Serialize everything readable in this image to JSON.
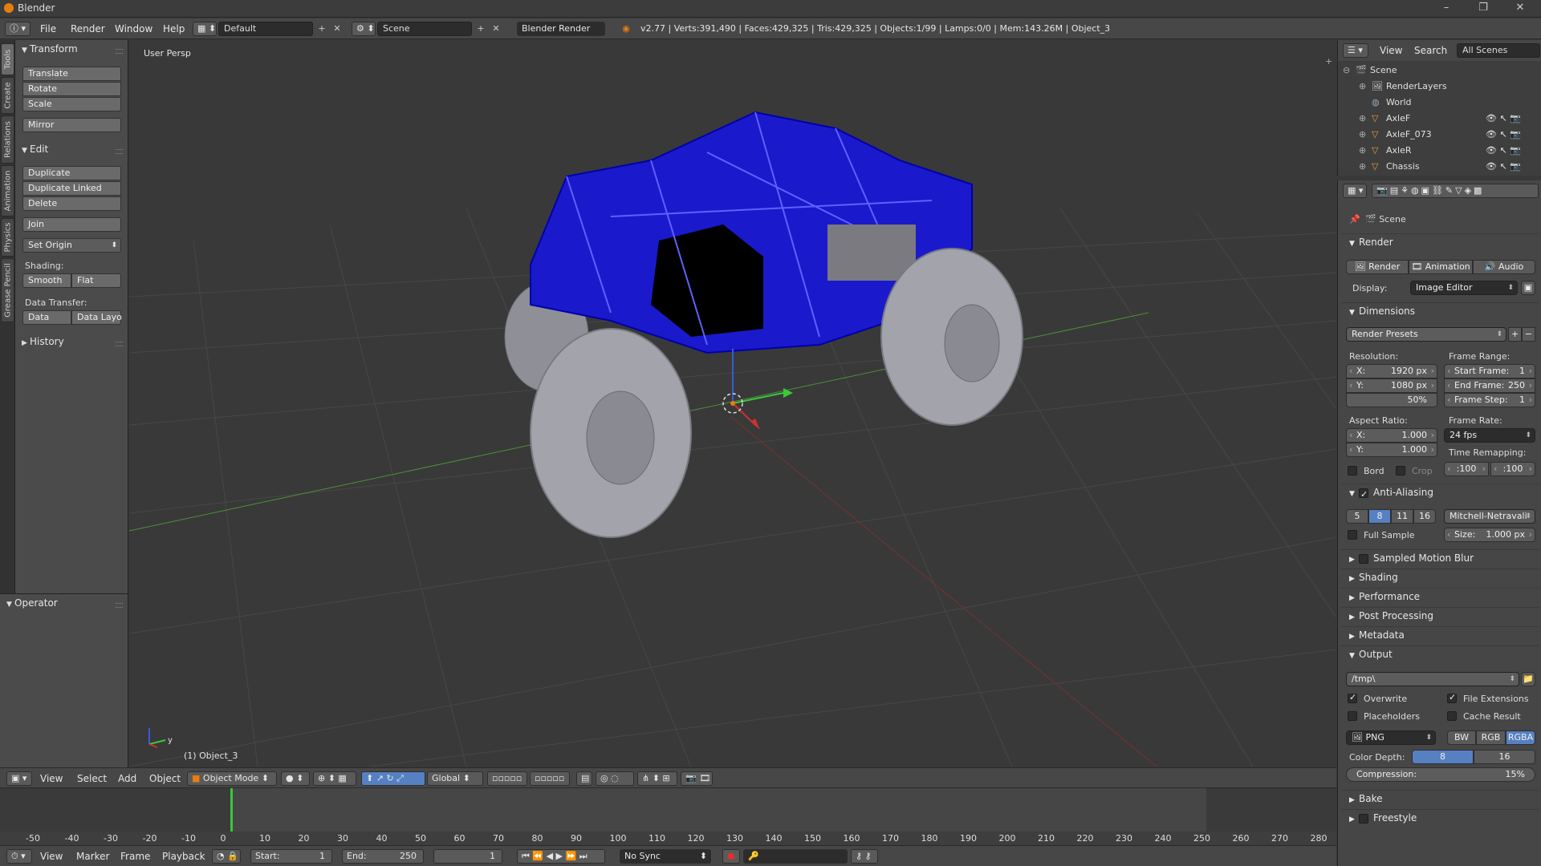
{
  "title_bar": {
    "title": "Blender",
    "minimize": "–",
    "maximize": "❐",
    "close": "✕"
  },
  "info_header": {
    "menus": [
      "File",
      "Render",
      "Window",
      "Help"
    ],
    "layout": "Default",
    "scene": "Scene",
    "engine": "Blender Render",
    "stats": "v2.77 | Verts:391,490 | Faces:429,325 | Tris:429,325 | Objects:1/99 | Lamps:0/0 | Mem:143.26M | Object_3"
  },
  "vertical_tabs": [
    "Tools",
    "Create",
    "Relations",
    "Animation",
    "Physics",
    "Grease Pencil"
  ],
  "tool_shelf": {
    "transform_header": "Transform",
    "translate": "Translate",
    "rotate": "Rotate",
    "scale": "Scale",
    "mirror": "Mirror",
    "edit_header": "Edit",
    "duplicate": "Duplicate",
    "duplicate_linked": "Duplicate Linked",
    "delete": "Delete",
    "join": "Join",
    "set_origin": "Set Origin",
    "shading_label": "Shading:",
    "smooth": "Smooth",
    "flat": "Flat",
    "data_transfer_label": "Data Transfer:",
    "data": "Data",
    "data_layout": "Data Layo",
    "history_header": "History"
  },
  "operator_panel": {
    "header": "Operator"
  },
  "viewport": {
    "view_name": "User Persp",
    "object_name": "(1) Object_3",
    "axis_y": "y"
  },
  "view3d_header": {
    "menus": [
      "View",
      "Select",
      "Add",
      "Object"
    ],
    "mode": "Object Mode",
    "orientation": "Global"
  },
  "timeline": {
    "ruler_labels": [
      "-50",
      "-40",
      "-30",
      "-20",
      "-10",
      "0",
      "10",
      "20",
      "30",
      "40",
      "50",
      "60",
      "70",
      "80",
      "90",
      "100",
      "110",
      "120",
      "130",
      "140",
      "150",
      "160",
      "170",
      "180",
      "190",
      "200",
      "210",
      "220",
      "230",
      "240",
      "250",
      "260",
      "270",
      "280"
    ],
    "menus": [
      "View",
      "Marker",
      "Frame",
      "Playback"
    ],
    "start_label": "Start:",
    "start_value": "1",
    "end_label": "End:",
    "end_value": "250",
    "current_frame": "1",
    "sync": "No Sync"
  },
  "outliner": {
    "menus": [
      "View",
      "Search"
    ],
    "filter": "All Scenes",
    "items": [
      "Scene",
      "RenderLayers",
      "World",
      "AxleF",
      "AxleF_073",
      "AxleR",
      "Chassis"
    ]
  },
  "properties": {
    "context": "Scene",
    "render_section": "Render",
    "render_btn": "Render",
    "animation_btn": "Animation",
    "audio_btn": "Audio",
    "display_label": "Display:",
    "display_value": "Image Editor",
    "dimensions_section": "Dimensions",
    "render_presets": "Render Presets",
    "resolution_label": "Resolution:",
    "res_x_label": "X:",
    "res_x": "1920 px",
    "res_y_label": "Y:",
    "res_y": "1080 px",
    "res_pct": "50%",
    "frame_range_label": "Frame Range:",
    "start_frame_label": "Start Frame:",
    "start_frame": "1",
    "end_frame_label": "End Frame:",
    "end_frame": "250",
    "frame_step_label": "Frame Step:",
    "frame_step": "1",
    "aspect_label": "Aspect Ratio:",
    "asp_x_label": "X:",
    "asp_x": "1.000",
    "asp_y_label": "Y:",
    "asp_y": "1.000",
    "frame_rate_label": "Frame Rate:",
    "frame_rate": "24 fps",
    "time_remap_label": "Time Remapping:",
    "remap_old": ":100",
    "remap_new": ":100",
    "bord": "Bord",
    "crop": "Crop",
    "aa_section": "Anti-Aliasing",
    "aa_samples": [
      "5",
      "8",
      "11",
      "16"
    ],
    "aa_filter": "Mitchell-Netravali",
    "full_sample": "Full Sample",
    "size_label": "Size:",
    "size_value": "1.000 px",
    "smb_section": "Sampled Motion Blur",
    "shading_section": "Shading",
    "performance_section": "Performance",
    "post_section": "Post Processing",
    "metadata_section": "Metadata",
    "output_section": "Output",
    "output_path": "/tmp\\",
    "overwrite": "Overwrite",
    "file_extensions": "File Extensions",
    "placeholders": "Placeholders",
    "cache_result": "Cache Result",
    "file_format": "PNG",
    "bw": "BW",
    "rgb": "RGB",
    "rgba": "RGBA",
    "color_depth_label": "Color Depth:",
    "depth_8": "8",
    "depth_16": "16",
    "compression_label": "Compression:",
    "compression_value": "15%",
    "bake_section": "Bake",
    "freestyle_section": "Freestyle"
  },
  "colors": {
    "accent": "#5680c2",
    "cage": "#1a1acc",
    "tire": "#9a9aa2"
  }
}
